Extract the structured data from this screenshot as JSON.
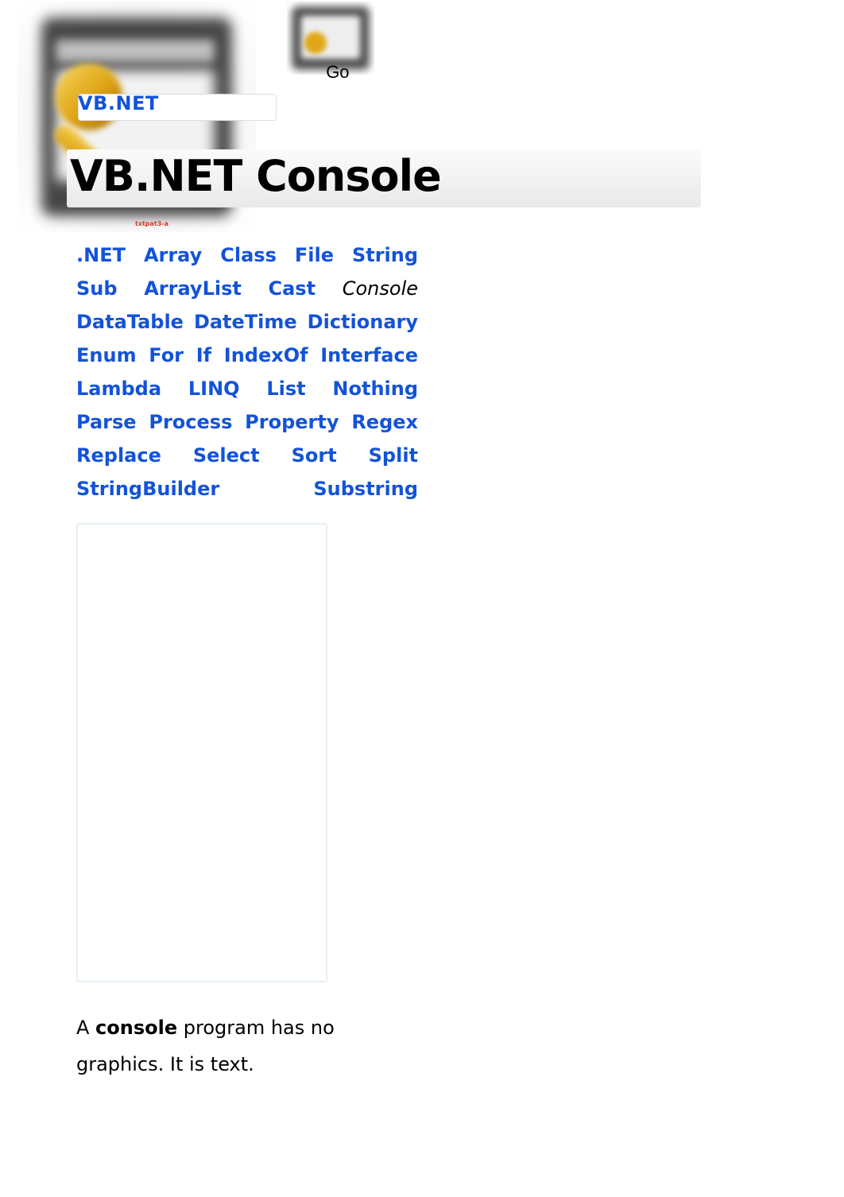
{
  "header": {
    "go_label": "Go",
    "search_value": "",
    "breadcrumb_link": "VB.NET",
    "tiny_label": "txtpat3-a"
  },
  "title": "VB.NET Console",
  "tags": [
    {
      "label": ".NET",
      "current": false
    },
    {
      "label": "Array",
      "current": false
    },
    {
      "label": "Class",
      "current": false
    },
    {
      "label": "File",
      "current": false
    },
    {
      "label": "String",
      "current": false
    },
    {
      "label": "Sub",
      "current": false
    },
    {
      "label": "ArrayList",
      "current": false
    },
    {
      "label": "Cast",
      "current": false
    },
    {
      "label": "Console",
      "current": true
    },
    {
      "label": "DataTable",
      "current": false
    },
    {
      "label": "DateTime",
      "current": false
    },
    {
      "label": "Dictionary",
      "current": false
    },
    {
      "label": "Enum",
      "current": false
    },
    {
      "label": "For",
      "current": false
    },
    {
      "label": "If",
      "current": false
    },
    {
      "label": "IndexOf",
      "current": false
    },
    {
      "label": "Interface",
      "current": false
    },
    {
      "label": "Lambda",
      "current": false
    },
    {
      "label": "LINQ",
      "current": false
    },
    {
      "label": "List",
      "current": false
    },
    {
      "label": "Nothing",
      "current": false
    },
    {
      "label": "Parse",
      "current": false
    },
    {
      "label": "Process",
      "current": false
    },
    {
      "label": "Property",
      "current": false
    },
    {
      "label": "Regex",
      "current": false
    },
    {
      "label": "Replace",
      "current": false
    },
    {
      "label": "Select",
      "current": false
    },
    {
      "label": "Sort",
      "current": false
    },
    {
      "label": "Split",
      "current": false
    },
    {
      "label": "StringBuilder",
      "current": false
    },
    {
      "label": "Substring",
      "current": false
    }
  ],
  "body": {
    "prefix": "A ",
    "bold": "console",
    "suffix": " program has no graphics. It is text."
  }
}
